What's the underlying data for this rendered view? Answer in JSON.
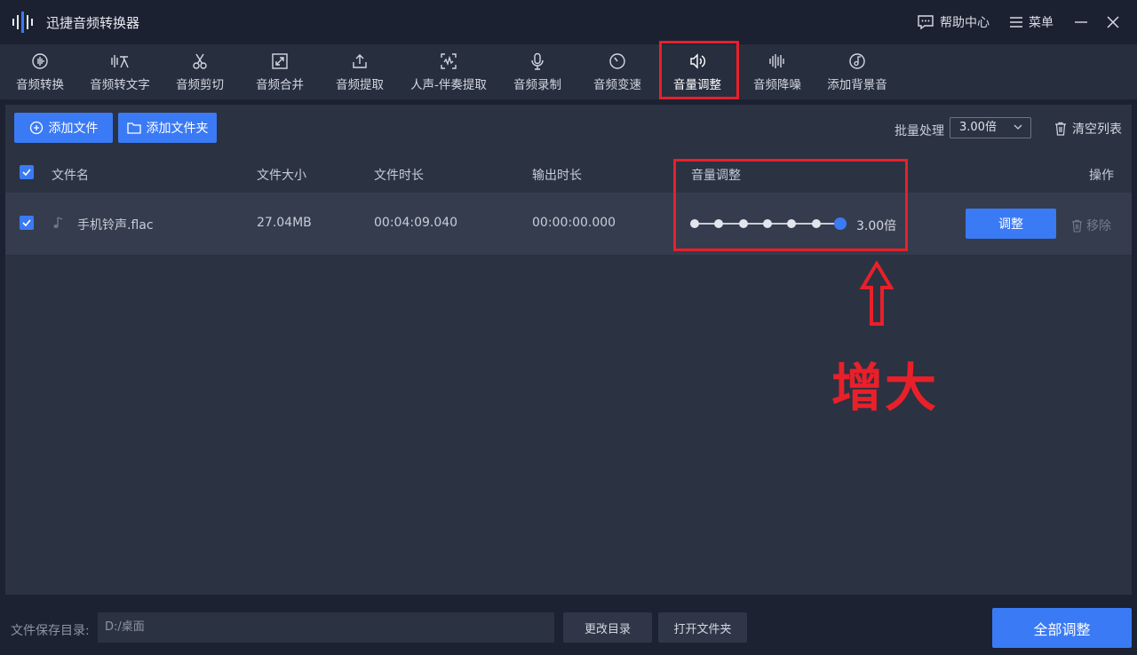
{
  "app": {
    "title": "迅捷音频转换器"
  },
  "titlebar": {
    "help_label": "帮助中心",
    "menu_label": "菜单"
  },
  "toolbar": {
    "tools": [
      {
        "label": "音频转换",
        "icon": "audio-convert-icon"
      },
      {
        "label": "音频转文字",
        "icon": "speech-to-text-icon"
      },
      {
        "label": "音频剪切",
        "icon": "scissors-icon"
      },
      {
        "label": "音频合并",
        "icon": "merge-icon"
      },
      {
        "label": "音频提取",
        "icon": "upload-icon"
      },
      {
        "label": "人声-伴奏提取",
        "icon": "vocal-extract-icon"
      },
      {
        "label": "音频录制",
        "icon": "microphone-icon"
      },
      {
        "label": "音频变速",
        "icon": "speed-dial-icon"
      },
      {
        "label": "音量调整",
        "icon": "volume-icon"
      },
      {
        "label": "音频降噪",
        "icon": "noise-reduce-icon"
      },
      {
        "label": "添加背景音",
        "icon": "music-disc-icon"
      }
    ],
    "active_index": 8
  },
  "actions": {
    "add_file_label": "添加文件",
    "add_folder_label": "添加文件夹",
    "batch_label": "批量处理",
    "batch_value": "3.00倍",
    "clear_label": "清空列表"
  },
  "table": {
    "headers": {
      "name": "文件名",
      "size": "文件大小",
      "duration": "文件时长",
      "output_duration": "输出时长",
      "volume": "音量调整",
      "operation": "操作"
    },
    "rows": [
      {
        "name": "手机铃声.flac",
        "size": "27.04MB",
        "duration": "00:04:09.040",
        "output_duration": "00:00:00.000",
        "volume_level_fraction": 1.0,
        "volume_text": "3.00倍",
        "adjust_label": "调整",
        "remove_label": "移除"
      }
    ]
  },
  "annotation": {
    "text": "增大",
    "color": "#e8202a"
  },
  "footer": {
    "save_dir_label": "文件保存目录:",
    "save_dir_value": "D:/桌面",
    "change_dir_label": "更改目录",
    "open_folder_label": "打开文件夹",
    "adjust_all_label": "全部调整"
  },
  "colors": {
    "accent": "#3a7af5",
    "highlight": "#e8202a",
    "background": "#1c2232"
  }
}
